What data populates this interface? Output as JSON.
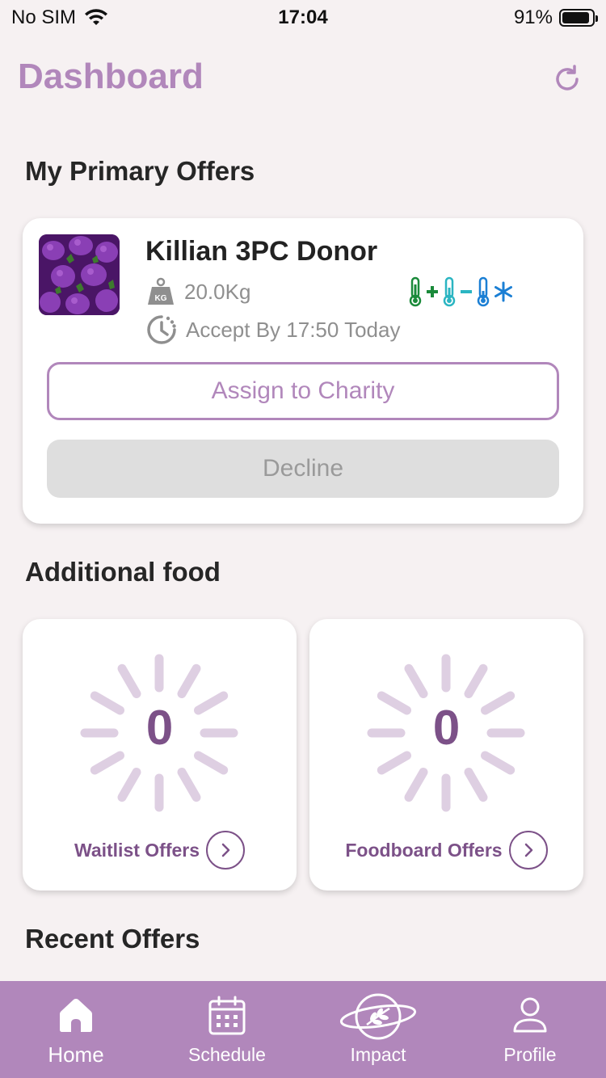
{
  "status_bar": {
    "carrier": "No SIM",
    "time": "17:04",
    "battery": "91%",
    "battery_level": 0.91
  },
  "header": {
    "title": "Dashboard"
  },
  "primary_section": {
    "title": "My Primary Offers"
  },
  "primary_offer": {
    "donor": "Killian 3PC Donor",
    "weight": "20.0Kg",
    "weight_icon_label": "KG",
    "accept_by": "Accept By 17:50 Today",
    "temperature_icons": [
      "thermometer-ambient-icon",
      "thermometer-chilled-icon",
      "thermometer-frozen-icon"
    ],
    "assign_label": "Assign to Charity",
    "decline_label": "Decline"
  },
  "additional_section": {
    "title": "Additional food"
  },
  "additional_cards": [
    {
      "count": "0",
      "label": "Waitlist Offers"
    },
    {
      "count": "0",
      "label": "Foodboard Offers"
    }
  ],
  "recent_section": {
    "title": "Recent Offers"
  },
  "tabs": [
    {
      "label": "Home",
      "icon": "home-icon"
    },
    {
      "label": "Schedule",
      "icon": "calendar-icon"
    },
    {
      "label": "Impact",
      "icon": "planet-leaf-icon"
    },
    {
      "label": "Profile",
      "icon": "person-icon"
    }
  ],
  "colors": {
    "accent": "#b187bb",
    "accent_dark": "#7c5188",
    "background": "#f6f1f2",
    "tab_bar": "#b187bb"
  }
}
